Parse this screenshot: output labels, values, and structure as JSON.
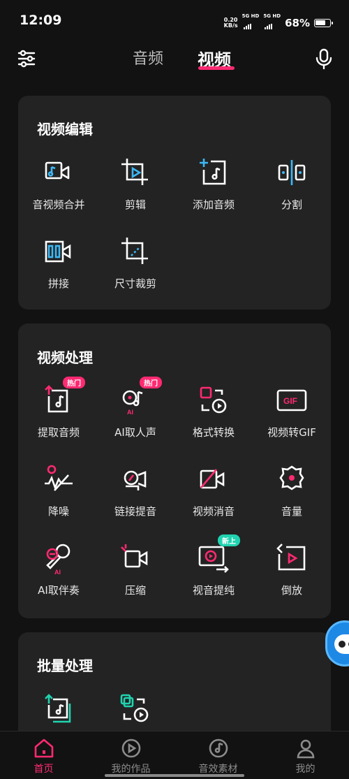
{
  "status_bar": {
    "time": "12:09",
    "net_speed_value": "0.20",
    "net_speed_unit": "KB/s",
    "sim1": "5G HD",
    "sim2": "5G HD",
    "battery": "68%"
  },
  "top_nav": {
    "tabs": [
      {
        "label": "音频"
      },
      {
        "label": "视频"
      }
    ],
    "active_tab": "视频",
    "left_icon": "sliders-icon",
    "right_icon": "microphone-icon"
  },
  "sections": [
    {
      "title": "视频编辑",
      "tools": [
        {
          "label": "音视频合并",
          "icon": "video-merge-icon"
        },
        {
          "label": "剪辑",
          "icon": "crop-play-icon"
        },
        {
          "label": "添加音频",
          "icon": "add-audio-icon"
        },
        {
          "label": "分割",
          "icon": "split-icon"
        },
        {
          "label": "拼接",
          "icon": "splice-icon"
        },
        {
          "label": "尺寸裁剪",
          "icon": "resize-crop-icon"
        }
      ]
    },
    {
      "title": "视频处理",
      "tools": [
        {
          "label": "提取音频",
          "icon": "extract-audio-icon",
          "tag": "热门"
        },
        {
          "label": "AI取人声",
          "icon": "ai-vocal-icon",
          "tag": "热门",
          "badge": "AI"
        },
        {
          "label": "格式转换",
          "icon": "format-convert-icon"
        },
        {
          "label": "视频转GIF",
          "icon": "gif-icon",
          "badge": "GIF"
        },
        {
          "label": "降噪",
          "icon": "denoise-icon"
        },
        {
          "label": "链接提音",
          "icon": "link-audio-icon"
        },
        {
          "label": "视频消音",
          "icon": "mute-video-icon"
        },
        {
          "label": "音量",
          "icon": "volume-icon"
        },
        {
          "label": "AI取伴奏",
          "icon": "ai-accompaniment-icon",
          "badge": "AI"
        },
        {
          "label": "压缩",
          "icon": "compress-icon"
        },
        {
          "label": "视音提纯",
          "icon": "purify-icon",
          "tag": "新上"
        },
        {
          "label": "倒放",
          "icon": "reverse-icon"
        }
      ]
    },
    {
      "title": "批量处理",
      "tools": [
        {
          "label": "",
          "icon": "batch-extract-audio-icon"
        },
        {
          "label": "",
          "icon": "batch-convert-icon"
        }
      ]
    }
  ],
  "bottom_nav": [
    {
      "label": "首页",
      "icon": "home-icon",
      "active": true
    },
    {
      "label": "我的作品",
      "icon": "works-play-icon",
      "active": false
    },
    {
      "label": "音效素材",
      "icon": "sound-material-icon",
      "active": false
    },
    {
      "label": "我的",
      "icon": "profile-icon",
      "active": false
    }
  ],
  "colors": {
    "accent": "#ff2a72",
    "teal": "#20d3b0",
    "blue": "#3db8f5",
    "card": "#232323",
    "background": "#121212"
  }
}
